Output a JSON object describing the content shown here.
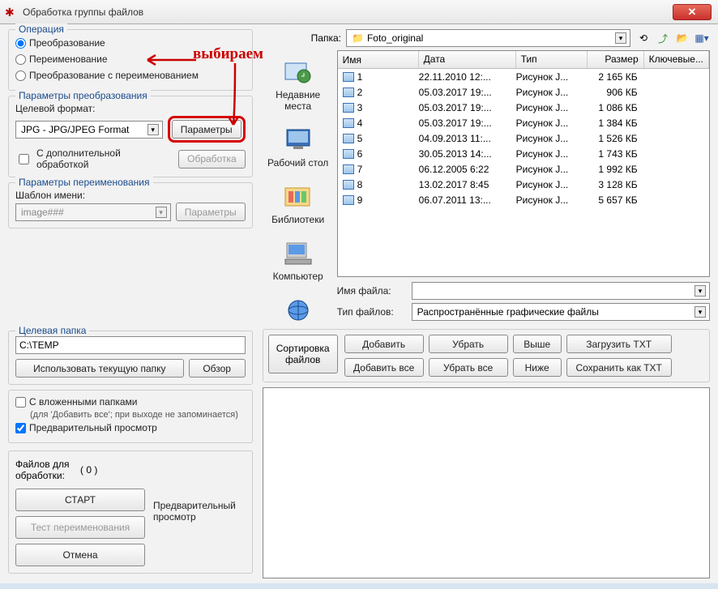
{
  "window": {
    "title": "Обработка группы файлов"
  },
  "annotation": {
    "text": "выбираем"
  },
  "operation": {
    "group_title": "Операция",
    "opt_convert": "Преобразование",
    "opt_rename": "Переименование",
    "opt_both": "Преобразование с переименованием"
  },
  "convert_params": {
    "group_title": "Параметры преобразования",
    "target_label": "Целевой формат:",
    "target_value": "JPG - JPG/JPEG Format",
    "params_btn": "Параметры",
    "extra_proc_label": "С дополнительной обработкой",
    "process_btn": "Обработка"
  },
  "rename_params": {
    "group_title": "Параметры переименования",
    "template_label": "Шаблон имени:",
    "template_value": "image###",
    "params_btn": "Параметры"
  },
  "target_folder": {
    "label": "Целевая папка",
    "value": "C:\\TEMP",
    "use_current_btn": "Использовать текущую папку",
    "browse_btn": "Обзор"
  },
  "options": {
    "subfolders_label": "С вложенными папками",
    "subfolders_hint": "(для 'Добавить все'; при выходе не запоминается)",
    "preview_label": "Предварительный просмотр"
  },
  "stats": {
    "files_label": "Файлов для обработки:",
    "count": "( 0 )",
    "start_btn": "СТАРТ",
    "test_btn": "Тест переименования",
    "cancel_btn": "Отмена",
    "preview_title": "Предварительный просмотр"
  },
  "folder_bar": {
    "label": "Папка:",
    "value": "Foto_original"
  },
  "columns": {
    "name": "Имя",
    "date": "Дата",
    "type": "Тип",
    "size": "Размер",
    "keywords": "Ключевые..."
  },
  "files": [
    {
      "name": "1",
      "date": "22.11.2010 12:...",
      "type": "Рисунок J...",
      "size": "2 165 КБ"
    },
    {
      "name": "2",
      "date": "05.03.2017 19:...",
      "type": "Рисунок J...",
      "size": "906 КБ"
    },
    {
      "name": "3",
      "date": "05.03.2017 19:...",
      "type": "Рисунок J...",
      "size": "1 086 КБ"
    },
    {
      "name": "4",
      "date": "05.03.2017 19:...",
      "type": "Рисунок J...",
      "size": "1 384 КБ"
    },
    {
      "name": "5",
      "date": "04.09.2013 11:...",
      "type": "Рисунок J...",
      "size": "1 526 КБ"
    },
    {
      "name": "6",
      "date": "30.05.2013 14:...",
      "type": "Рисунок J...",
      "size": "1 743 КБ"
    },
    {
      "name": "7",
      "date": "06.12.2005 6:22",
      "type": "Рисунок J...",
      "size": "1 992 КБ"
    },
    {
      "name": "8",
      "date": "13.02.2017 8:45",
      "type": "Рисунок J...",
      "size": "3 128 КБ"
    },
    {
      "name": "9",
      "date": "06.07.2011 13:...",
      "type": "Рисунок J...",
      "size": "5 657 КБ"
    }
  ],
  "file_inputs": {
    "name_label": "Имя файла:",
    "name_value": "",
    "type_label": "Тип файлов:",
    "type_value": "Распространённые графические файлы"
  },
  "actions": {
    "sort": "Сортировка файлов",
    "add": "Добавить",
    "remove": "Убрать",
    "up": "Выше",
    "load_txt": "Загрузить TXT",
    "add_all": "Добавить все",
    "remove_all": "Убрать все",
    "down": "Ниже",
    "save_txt": "Сохранить как TXT"
  },
  "shortcuts": {
    "recent": "Недавние места",
    "desktop": "Рабочий стол",
    "libraries": "Библиотеки",
    "computer": "Компьютер"
  }
}
